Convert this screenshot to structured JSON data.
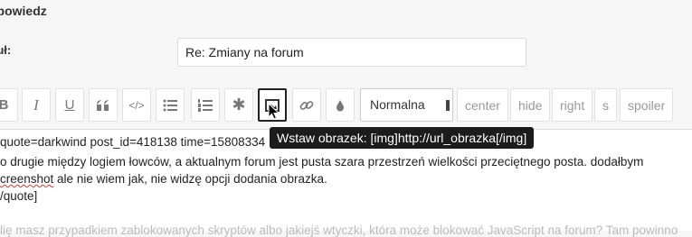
{
  "form": {
    "heading": "dpowiedz",
    "subject_label": "tuł:",
    "subject_value": "Re: Zmiany na forum"
  },
  "toolbar": {
    "buttons": {
      "bold": "B",
      "italic": "I",
      "underline": "U"
    },
    "size_select": "Normalna",
    "text_buttons": [
      "center",
      "hide",
      "right",
      "s",
      "spoiler"
    ]
  },
  "tooltip": "Wstaw obrazek: [img]http://url_obrazka[/img]",
  "editor": {
    "line1_prefix": "quote=darkwind post_id=418138 time=15808334",
    "line2": "o drugie między logiem łowców, a aktualnym forum jest pusta szara przestrzeń  wielkości przeciętnego posta. dodałbym",
    "line3_spell": "creenshot",
    "line3_rest": " ale nie wiem jak, nie widzę opcji dodania obrazka.",
    "line4": "/quote]",
    "line6": "lię masz przypadkiem zablokowanych skryptów albo jakiejś wtyczki, która może blokować JavaScript na forum? Tam powinno"
  }
}
